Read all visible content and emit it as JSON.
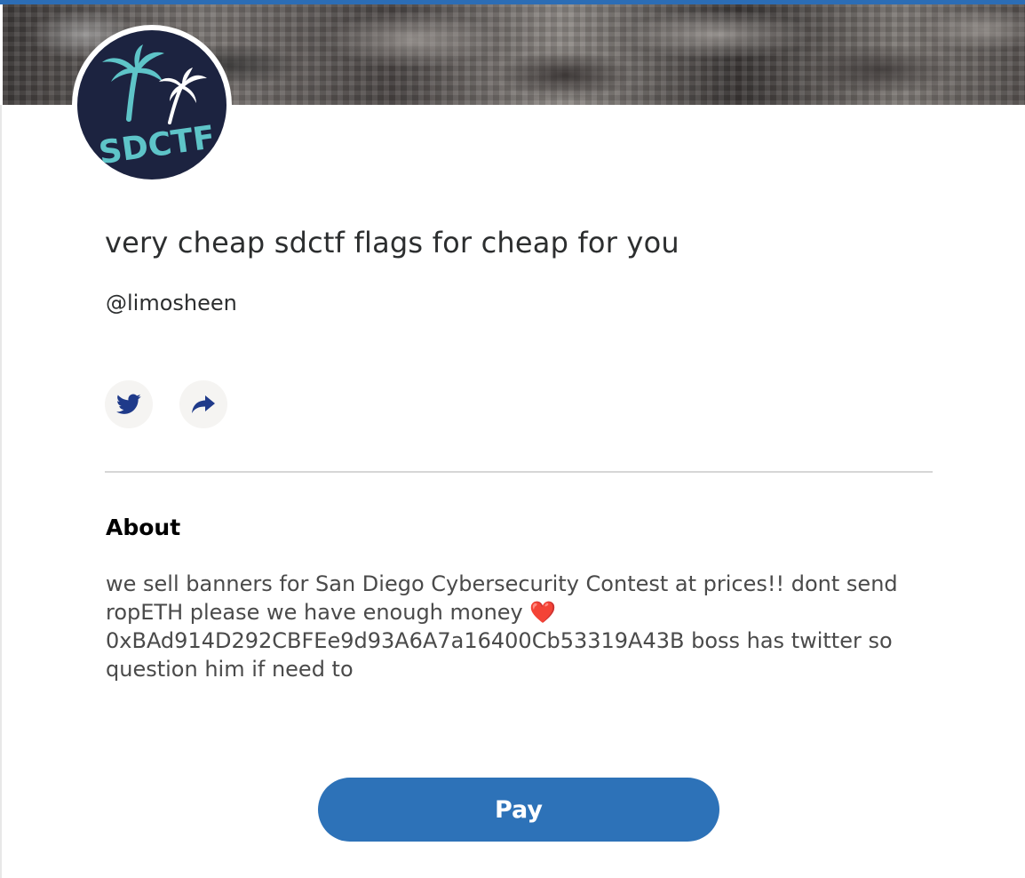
{
  "colors": {
    "accent": "#2c6db5",
    "pay_button": "#2d72b8",
    "avatar_background": "#1c2340",
    "avatar_teal": "#5ec4c8",
    "icon_blue": "#1f3a8a"
  },
  "profile": {
    "avatar_text": "SDCTF",
    "title": "very cheap sdctf flags for cheap for you",
    "handle": "@limosheen"
  },
  "social": {
    "twitter_icon": "twitter-bird-icon",
    "share_icon": "share-arrow-icon"
  },
  "about": {
    "heading": "About",
    "body": "we sell banners for San Diego Cybersecurity Contest at prices!! dont send ropETH please we have enough money ❤️ 0xBAd914D292CBFEe9d93A6A7a16400Cb53319A43B boss has twitter so question him if need to"
  },
  "actions": {
    "pay_label": "Pay"
  }
}
